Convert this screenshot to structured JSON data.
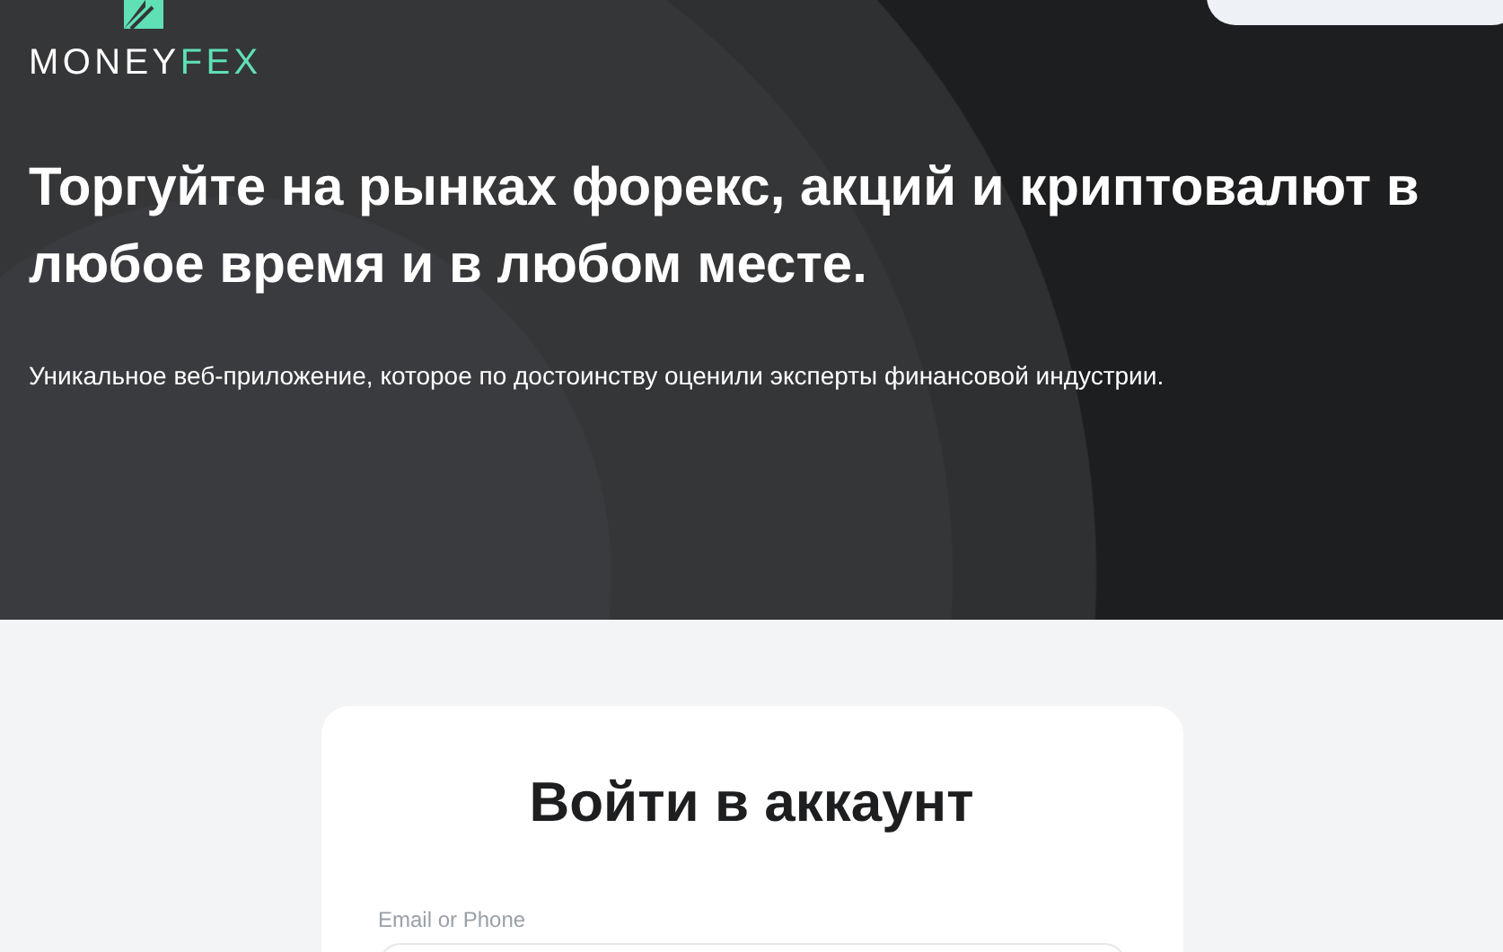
{
  "header": {
    "logo": {
      "word_1": "MONEY",
      "word_2": "FEX"
    }
  },
  "hero": {
    "title": "Торгуйте на рынках форекс, акций и криптовалют в любое время и в любом месте.",
    "subtitle": "Уникальное веб-приложение, которое по достоинству оценили эксперты финансовой индустрии."
  },
  "login": {
    "title": "Войти в аккаунт",
    "fields": [
      {
        "label": "Email or Phone"
      }
    ]
  }
}
